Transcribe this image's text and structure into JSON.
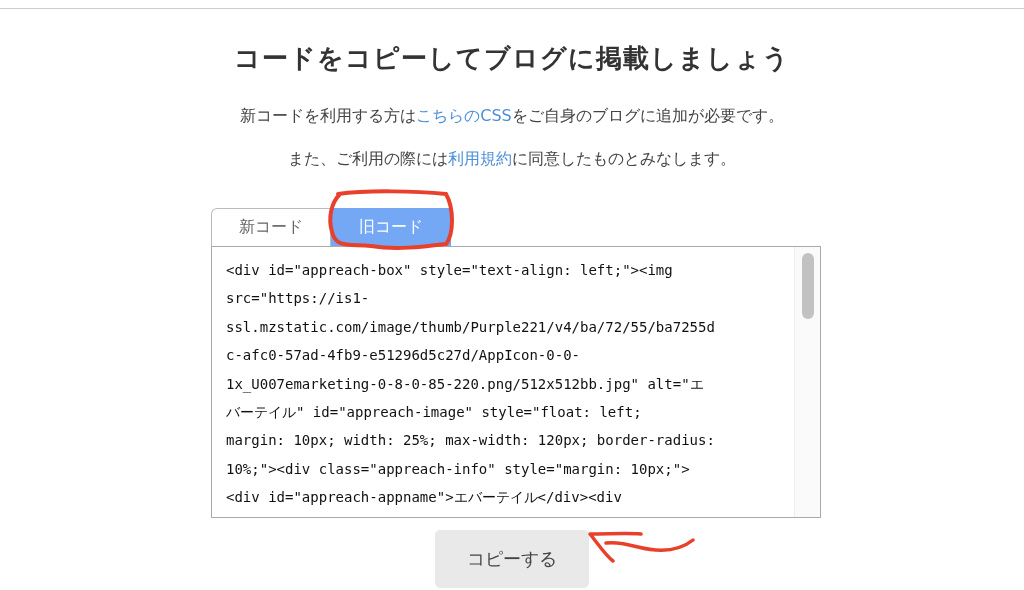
{
  "heading": "コードをコピーしてブログに掲載しましょう",
  "notes": [
    [
      {
        "kind": "text",
        "text": "新コードを利用する方は"
      },
      {
        "kind": "link",
        "text": "こちらのCSS"
      },
      {
        "kind": "text",
        "text": "をご自身のブログに追加が必要です。"
      }
    ],
    [
      {
        "kind": "text",
        "text": "また、ご利用の際には"
      },
      {
        "kind": "link",
        "text": "利用規約"
      },
      {
        "kind": "text",
        "text": "に同意したものとみなします。"
      }
    ]
  ],
  "tabs": [
    {
      "label": "新コード",
      "selected": false
    },
    {
      "label": "旧コード",
      "selected": true
    }
  ],
  "code_lines": [
    "<div id=\"appreach-box\" style=\"text-align: left;\"><img",
    "src=\"https://is1-",
    "ssl.mzstatic.com/image/thumb/Purple221/v4/ba/72/55/ba7255d",
    "c-afc0-57ad-4fb9-e51296d5c27d/AppIcon-0-0-",
    "1x_U007emarketing-0-8-0-85-220.png/512x512bb.jpg\" alt=\"エ",
    "バーテイル\" id=\"appreach-image\" style=\"float: left;",
    "margin: 10px; width: 25%; max-width: 120px; border-radius:",
    "10%;\"><div class=\"appreach-info\" style=\"margin: 10px;\">",
    "<div id=\"appreach-appname\">エバーテイル</div><div"
  ],
  "copy_button": "コピーする"
}
